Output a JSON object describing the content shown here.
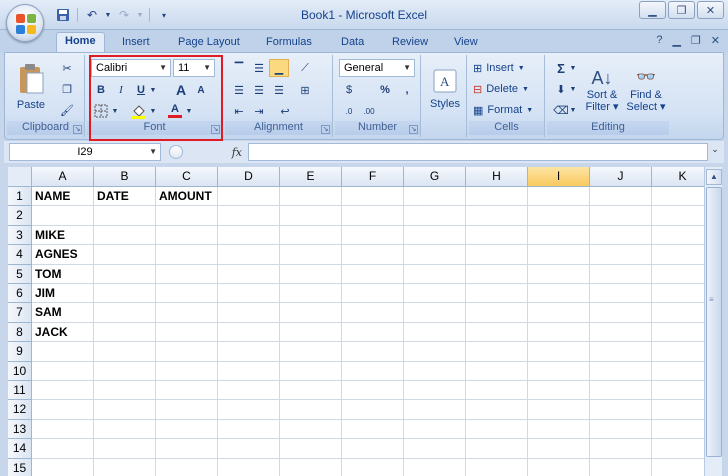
{
  "window": {
    "title": "Book1 - Microsoft Excel"
  },
  "qat": {
    "save_icon": "save-icon",
    "undo_icon": "undo-icon",
    "redo_icon": "redo-icon"
  },
  "tabs": [
    {
      "label": "Home",
      "active": true
    },
    {
      "label": "Insert"
    },
    {
      "label": "Page Layout"
    },
    {
      "label": "Formulas"
    },
    {
      "label": "Data"
    },
    {
      "label": "Review"
    },
    {
      "label": "View"
    }
  ],
  "ribbon": {
    "clipboard": {
      "label": "Clipboard",
      "paste": "Paste"
    },
    "font": {
      "label": "Font",
      "font_name": "Calibri",
      "font_size": "11",
      "bold": "B",
      "italic": "I",
      "underline": "U",
      "grow": "A",
      "shrink": "A",
      "font_color": "A"
    },
    "alignment": {
      "label": "Alignment"
    },
    "number": {
      "label": "Number",
      "format": "General",
      "percent": "%",
      "comma": ","
    },
    "styles": {
      "label": "Styles"
    },
    "cells": {
      "label": "Cells",
      "insert": "Insert",
      "delete": "Delete",
      "format": "Format"
    },
    "editing": {
      "label": "Editing",
      "sum": "Σ",
      "sort_filter_1": "Sort &",
      "sort_filter_2": "Filter",
      "find_select_1": "Find &",
      "find_select_2": "Select"
    }
  },
  "formula_bar": {
    "name_box": "I29",
    "fx": "fx",
    "formula": ""
  },
  "grid": {
    "columns": [
      "A",
      "B",
      "C",
      "D",
      "E",
      "F",
      "G",
      "H",
      "I",
      "J",
      "K"
    ],
    "selected_column": "I",
    "rows": [
      "1",
      "2",
      "3",
      "4",
      "5",
      "6",
      "7",
      "8",
      "9",
      "10",
      "11",
      "12",
      "13",
      "14",
      "15"
    ],
    "cells": {
      "A1": "NAME",
      "B1": "DATE",
      "C1": "AMOUNT",
      "A3": "MIKE",
      "A4": "AGNES",
      "A5": "TOM",
      "A6": "JIM",
      "A7": "SAM",
      "A8": "JACK"
    }
  }
}
